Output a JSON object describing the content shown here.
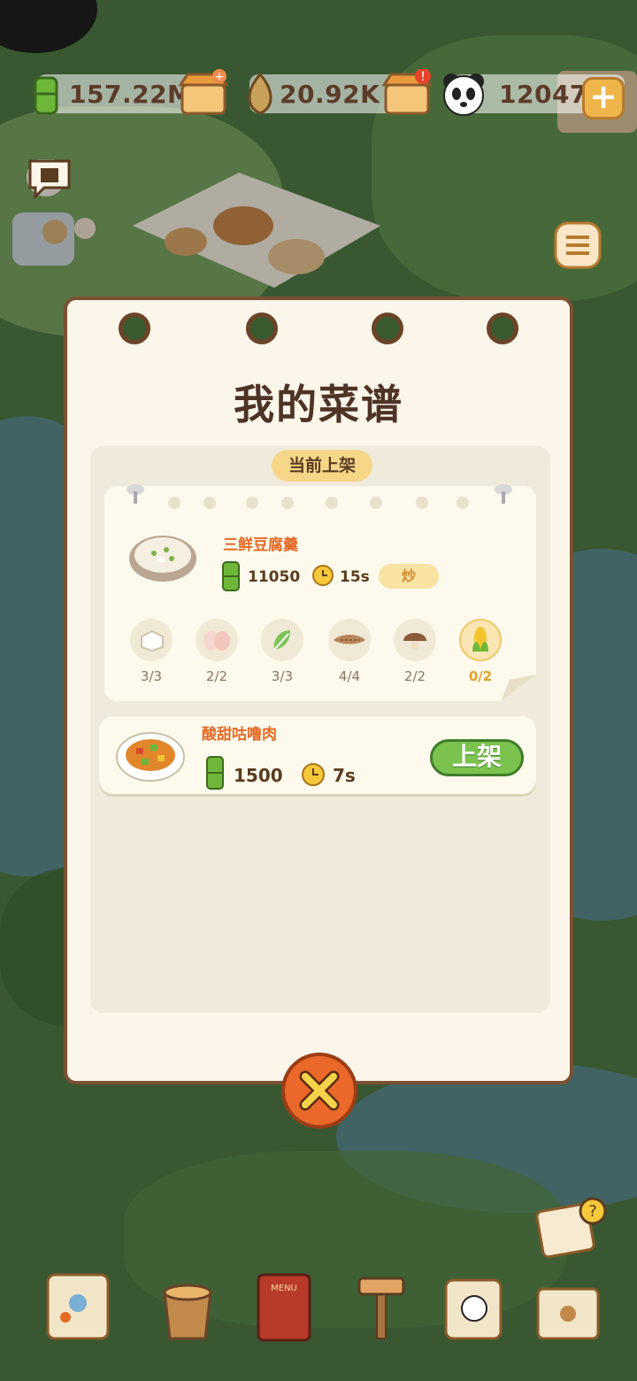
{
  "resources": {
    "bamboo_total": "157.22M",
    "bamboo_shoot": "20.92K",
    "panda_coins": "12047"
  },
  "colors": {
    "accent_orange": "#e56a25",
    "panel_bg": "#fbf6e9",
    "panel_border": "#7a5132",
    "shelve_green": "#7bc24f",
    "close_orange": "#e9682a"
  },
  "panel": {
    "title": "我的菜谱",
    "current_tag": "当前上架",
    "current_dish": {
      "name": "三鲜豆腐羹",
      "price": "11050",
      "time": "15s",
      "method": "炒",
      "ingredients": [
        {
          "icon": "tofu-icon",
          "count": "3/3"
        },
        {
          "icon": "egg-icon",
          "count": "2/2"
        },
        {
          "icon": "leafy-greens-icon",
          "count": "3/3"
        },
        {
          "icon": "shrimp-icon",
          "count": "4/4"
        },
        {
          "icon": "mushroom-icon",
          "count": "2/2"
        },
        {
          "icon": "corn-icon",
          "count": "0/2"
        }
      ]
    },
    "recipes": [
      {
        "name": "酸甜咕噜肉",
        "price": "1500",
        "time": "7s",
        "button": "上架"
      }
    ]
  }
}
